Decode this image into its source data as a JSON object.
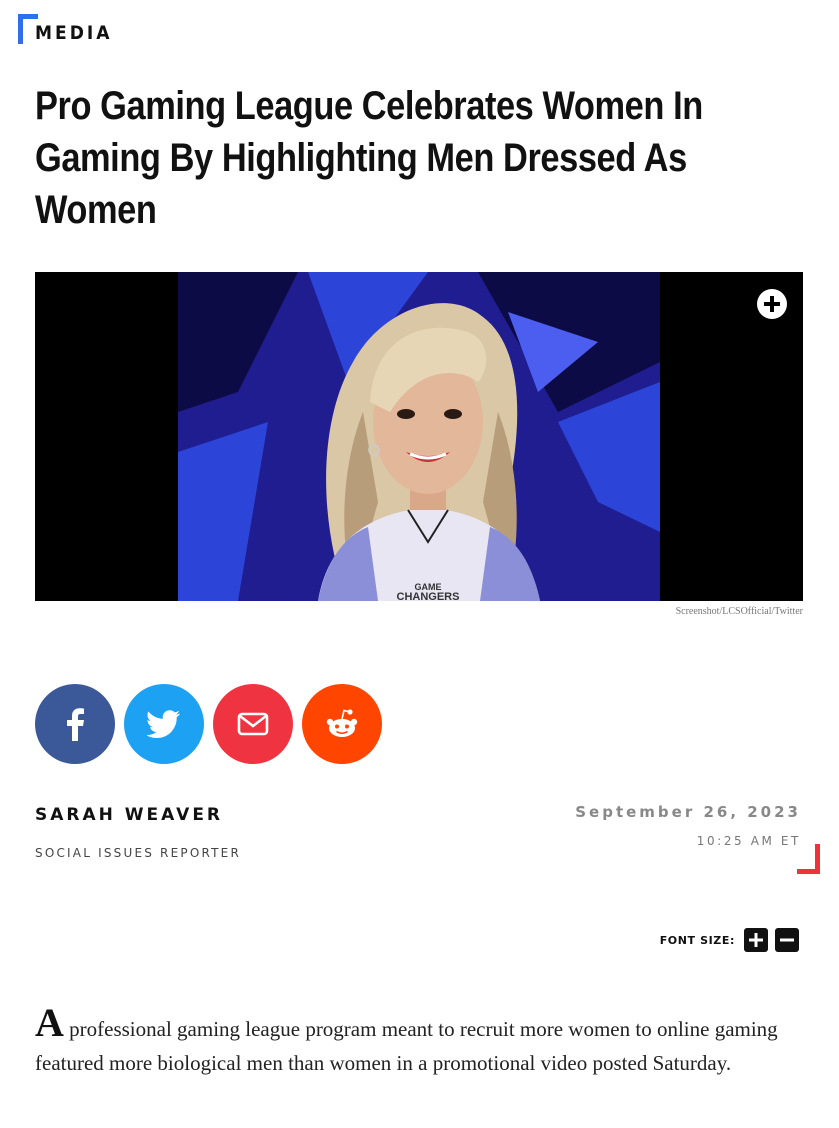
{
  "category": {
    "label": "MEDIA"
  },
  "headline": "Pro Gaming League Celebrates Women In Gaming By Highlighting Men Dressed As Women",
  "hero": {
    "credit": "Screenshot/LCSOfficial/Twitter",
    "jersey_text": "GAME CHANGERS",
    "expand_icon": "plus-circle-icon"
  },
  "share": [
    {
      "name": "facebook",
      "icon": "facebook-icon",
      "color": "#3b5998"
    },
    {
      "name": "twitter",
      "icon": "twitter-icon",
      "color": "#1da1f2"
    },
    {
      "name": "email",
      "icon": "mail-icon",
      "color": "#ef3340"
    },
    {
      "name": "reddit",
      "icon": "reddit-icon",
      "color": "#ff4500"
    }
  ],
  "byline": {
    "author": "SARAH WEAVER",
    "role": "SOCIAL ISSUES REPORTER",
    "date": "September 26, 2023",
    "time": "10:25 AM ET"
  },
  "font_size": {
    "label": "FONT SIZE:"
  },
  "body": {
    "dropcap": "A",
    "first_paragraph": "professional gaming league program meant to recruit more women to online gaming featured more biological men than women in a promotional video posted Saturday."
  },
  "colors": {
    "accent_blue": "#2f6fea",
    "accent_red": "#f0323d"
  }
}
